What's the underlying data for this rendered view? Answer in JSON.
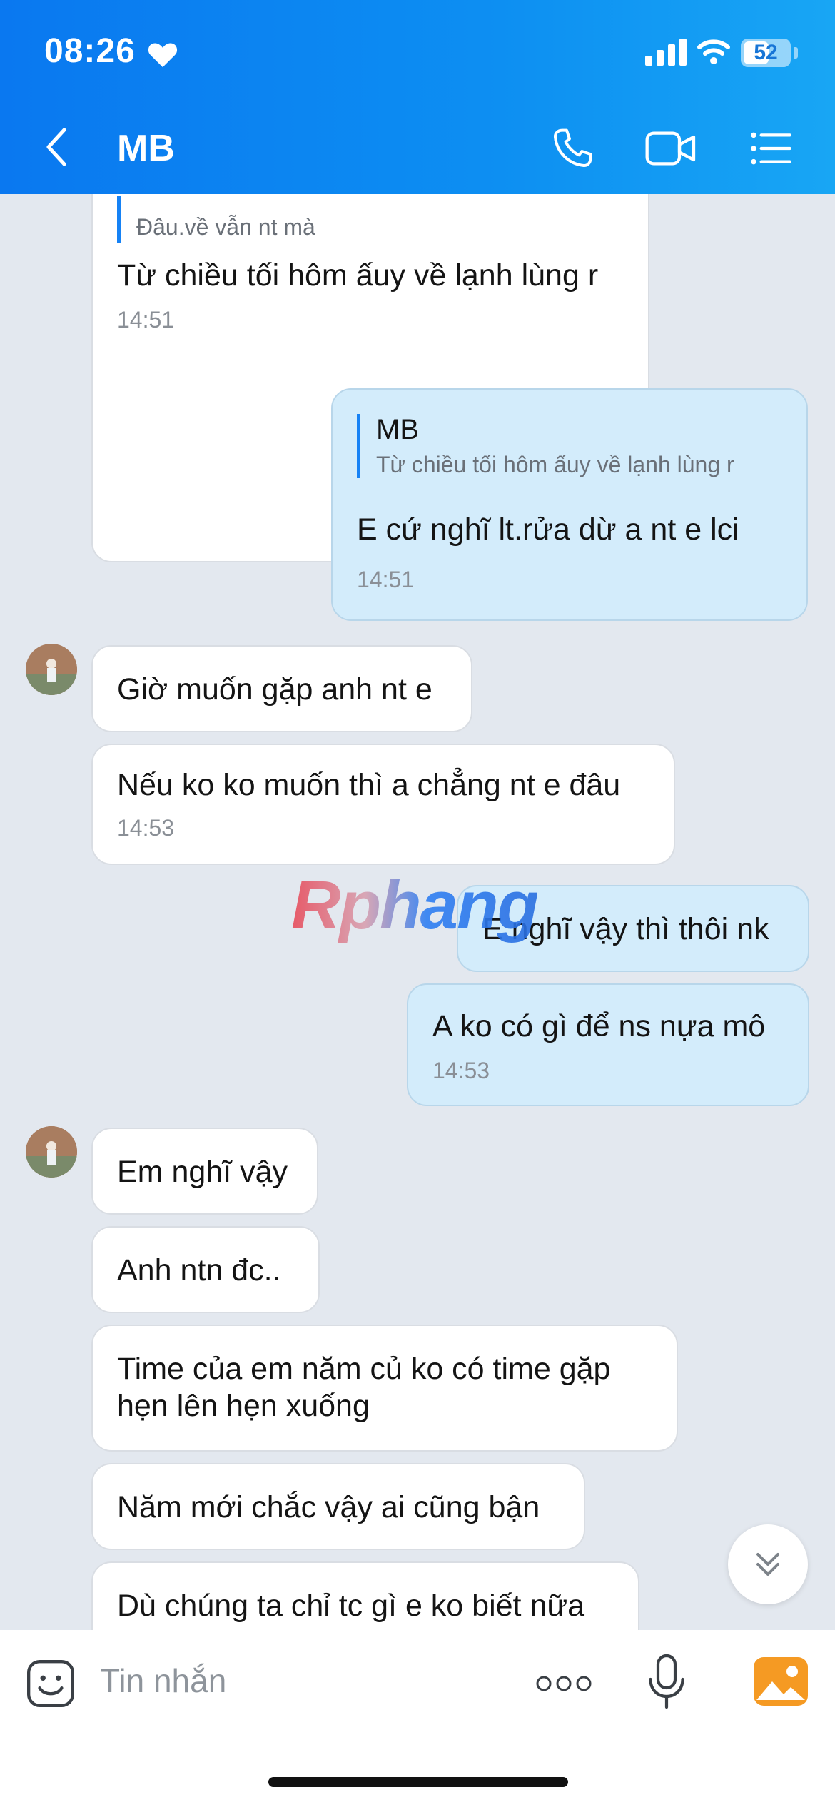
{
  "status_bar": {
    "time": "08:26",
    "battery": "52"
  },
  "header": {
    "title": "MB"
  },
  "watermark": "Rphang",
  "messages": [
    {
      "side": "recv",
      "quote_text": "Đâu.về vẫn nt mà",
      "text": "Từ chiều tối hôm ấuy về lạnh lùng r",
      "time": "14:51"
    },
    {
      "side": "sent",
      "quote_name": "MB",
      "quote_text": "Từ chiều tối hôm ấuy về lạnh lùng r",
      "text": "E cứ nghĩ lt.rửa dừ a nt e lci",
      "time": "14:51"
    },
    {
      "side": "recv",
      "text": "Giờ muốn gặp anh nt e"
    },
    {
      "side": "recv",
      "text": "Nếu ko ko muốn thì a chẳng nt e đâu",
      "time": "14:53"
    },
    {
      "side": "sent",
      "text": "E nghĩ vậy thì thôi nk"
    },
    {
      "side": "sent",
      "text": "A ko có gì để ns nựa mô",
      "time": "14:53"
    },
    {
      "side": "recv",
      "text": "Em nghĩ vậy"
    },
    {
      "side": "recv",
      "text": "Anh ntn đc.."
    },
    {
      "side": "recv",
      "text": "Time của em năm củ ko có time gặp\nhẹn lên hẹn xuống"
    },
    {
      "side": "recv",
      "text": "Năm mới chắc vậy ai cũng bận"
    },
    {
      "side": "recv",
      "text": "Dù chúng ta chỉ tc gì e ko biết nữa"
    }
  ],
  "composer": {
    "placeholder": "Tin nhắn"
  }
}
